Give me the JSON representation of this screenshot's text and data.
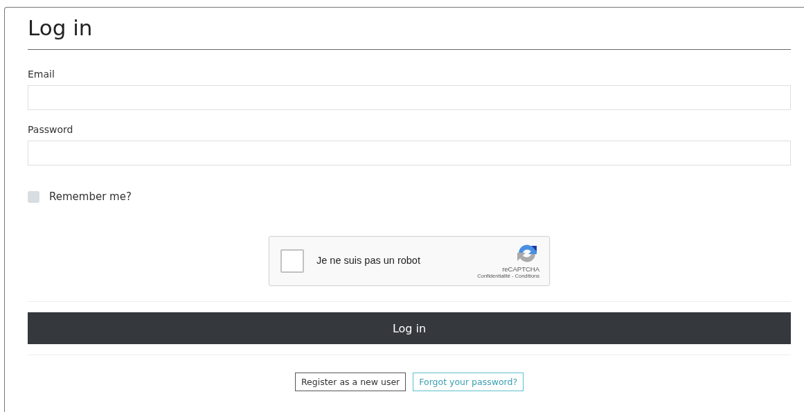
{
  "title": "Log in",
  "fields": [
    {
      "label": "Email"
    },
    {
      "label": "Password"
    }
  ],
  "remember": {
    "label": "Remember me?",
    "checked": false
  },
  "captcha": {
    "label": "Je ne suis pas un robot",
    "checked": false,
    "brand": "reCAPTCHA",
    "links": "Confidentialité - Conditions"
  },
  "submit": "Log in",
  "links": [
    {
      "label": "Register as a new user",
      "kind": "register"
    },
    {
      "label": "Forgot your password?",
      "kind": "forgot"
    }
  ]
}
